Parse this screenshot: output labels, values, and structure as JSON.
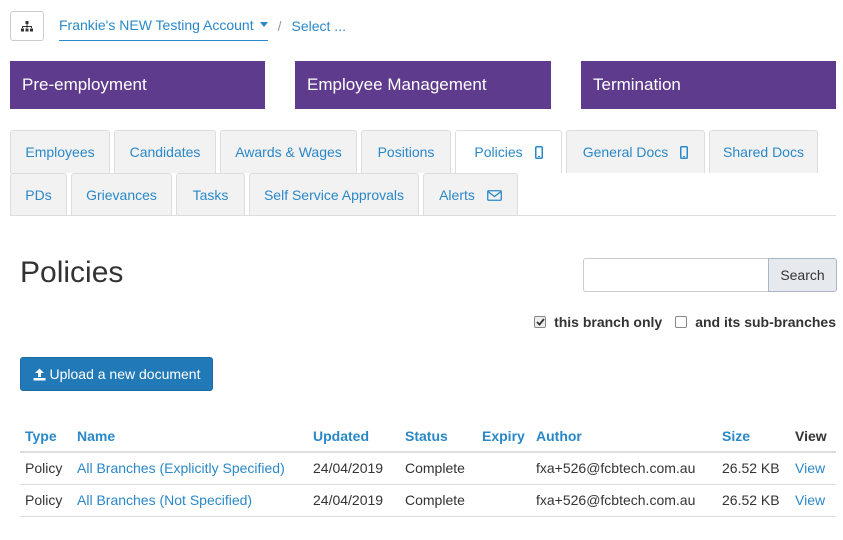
{
  "breadcrumb": {
    "account": "Frankie's NEW Testing Account",
    "separator": "/",
    "select": "Select ..."
  },
  "categories": [
    "Pre-employment",
    "Employee Management",
    "Termination"
  ],
  "tabs_row1": [
    "Employees",
    "Candidates",
    "Awards & Wages",
    "Positions",
    "Policies",
    "General Docs",
    "Shared Docs"
  ],
  "tabs_row2": [
    "PDs",
    "Grievances",
    "Tasks",
    "Self Service Approvals",
    "Alerts"
  ],
  "active_tab": "Policies",
  "page": {
    "title": "Policies"
  },
  "search": {
    "placeholder": "",
    "button_label": "Search"
  },
  "filters": {
    "this_branch_label": "this branch only",
    "this_branch_checked": true,
    "sub_branches_label": "and its sub-branches",
    "sub_branches_checked": false
  },
  "upload": {
    "label": "Upload a new document"
  },
  "table": {
    "headers": [
      "Type",
      "Name",
      "Updated",
      "Status",
      "Expiry",
      "Author",
      "Size",
      "View"
    ],
    "rows": [
      [
        "Policy",
        "All Branches (Explicitly Specified)",
        "24/04/2019",
        "Complete",
        "",
        "fxa+526@fcbtech.com.au",
        "26.52 KB",
        "View"
      ],
      [
        "Policy",
        "All Branches (Not Specified)",
        "24/04/2019",
        "Complete",
        "",
        "fxa+526@fcbtech.com.au",
        "26.52 KB",
        "View"
      ]
    ]
  },
  "colors": {
    "brand_purple": "#5e3b8d",
    "link_blue": "#2a88c8",
    "button_blue": "#2179b8"
  },
  "icons": {
    "branch_tree": "sitemap-icon",
    "mobile": "mobile-icon",
    "mail": "envelope-icon",
    "upload": "upload-icon",
    "dropdown": "caret-down-icon"
  }
}
